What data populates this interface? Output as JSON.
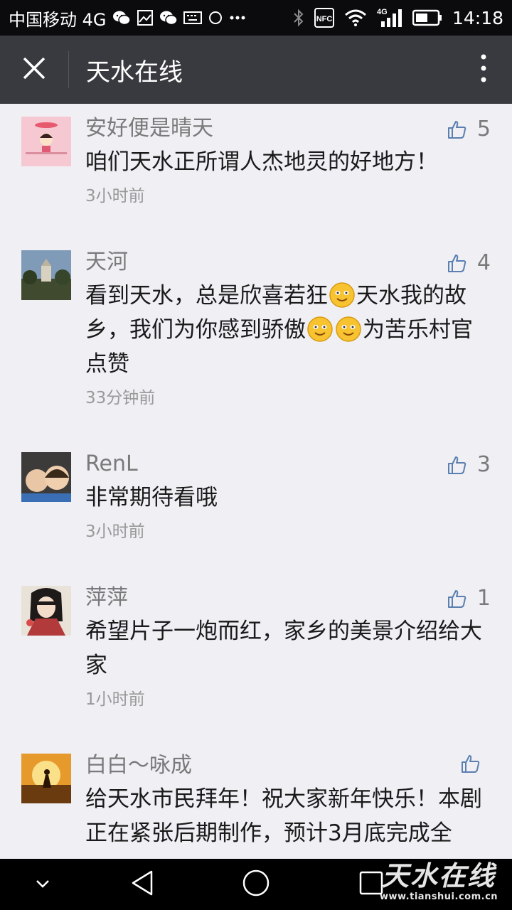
{
  "status_bar": {
    "carrier": "中国移动 4G",
    "network": "4G",
    "nfc": "NFC",
    "time": "14:18",
    "icons": [
      "wechat-icon",
      "image-icon",
      "wechat-icon",
      "keyboard-icon",
      "circle-icon",
      "more-dots-icon",
      "bluetooth-icon",
      "nfc-icon",
      "wifi-icon",
      "signal-icon",
      "battery-icon"
    ]
  },
  "app_bar": {
    "title": "天水在线",
    "close_icon": "close-icon",
    "more_icon": "more-vertical-icon",
    "background": "#393a3f"
  },
  "comments": [
    {
      "name": "安好便是晴天",
      "likes": "5",
      "text_parts": [
        "咱们天水正所谓人杰地灵的好地方！"
      ],
      "time": "3小时前",
      "avatar": "pink-cartoon-avatar"
    },
    {
      "name": "天河",
      "likes": "4",
      "text_parts": [
        "看到天水，总是欣喜若狂",
        "天水我的故乡，我们为你感到骄傲",
        "为苦乐村官点赞"
      ],
      "emojis": [
        "smile-emoji",
        "smile-emoji",
        "smile-emoji"
      ],
      "time": "33分钟前",
      "avatar": "landscape-avatar"
    },
    {
      "name": "RenL",
      "likes": "3",
      "text_parts": [
        "非常期待看哦"
      ],
      "time": "3小时前",
      "avatar": "kids-photo-avatar"
    },
    {
      "name": "萍萍",
      "likes": "1",
      "text_parts": [
        "希望片子一炮而红，家乡的美景介绍给大家"
      ],
      "time": "1小时前",
      "avatar": "anime-girl-avatar"
    },
    {
      "name": "白白～咏成",
      "likes": "",
      "text_parts": [
        "给天水市民拜年！祝大家新年快乐！本剧正在紧张后期制作，预计3月底完成全"
      ],
      "time": "",
      "avatar": "sunset-avatar"
    }
  ],
  "like_icon": "thumbs-up-icon",
  "nav_bar": {
    "buttons": [
      "chevron-down-icon",
      "back-triangle-icon",
      "home-circle-icon",
      "recent-square-icon"
    ]
  },
  "watermark": {
    "logo": "天水在线",
    "url": "www.tianshui.com.cn"
  }
}
